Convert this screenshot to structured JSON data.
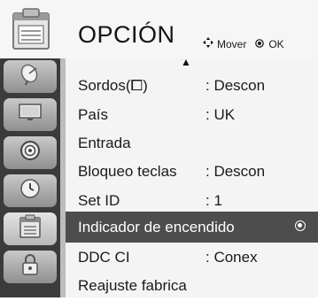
{
  "header": {
    "icon": "option-settings-icon",
    "title": "OPCIÓN",
    "hint_move_icon": "four-arrow-move-icon",
    "hint_move_label": "Mover",
    "hint_ok_icon": "ok-circle-icon",
    "hint_ok_label": "OK",
    "scroll_up_icon": "up-triangle-icon"
  },
  "tabs": [
    {
      "icon": "satellite-dish-icon",
      "active": false
    },
    {
      "icon": "monitor-picture-icon",
      "active": false
    },
    {
      "icon": "speaker-audio-icon",
      "active": false
    },
    {
      "icon": "clock-time-icon",
      "active": false
    },
    {
      "icon": "option-settings-icon",
      "active": true
    },
    {
      "icon": "padlock-icon",
      "active": false
    }
  ],
  "menu": {
    "items": [
      {
        "label": "Sordos(⧠)",
        "value": ": Descon"
      },
      {
        "label": "País",
        "value": ": UK"
      },
      {
        "label": "Entrada",
        "value": ""
      },
      {
        "label": "Bloqueo teclas",
        "value": ": Descon"
      },
      {
        "label": "Set ID",
        "value": ": 1"
      },
      {
        "label": "Indicador de encendido",
        "value": "",
        "selected": true
      },
      {
        "label": "DDC CI",
        "value": ": Conex"
      },
      {
        "label": "Reajuste fabrica",
        "value": ""
      }
    ]
  },
  "colors": {
    "tab_column": "#3b3b3b",
    "selected_row": "#4d4d4d",
    "panel_bg": "#f4f4f4"
  }
}
